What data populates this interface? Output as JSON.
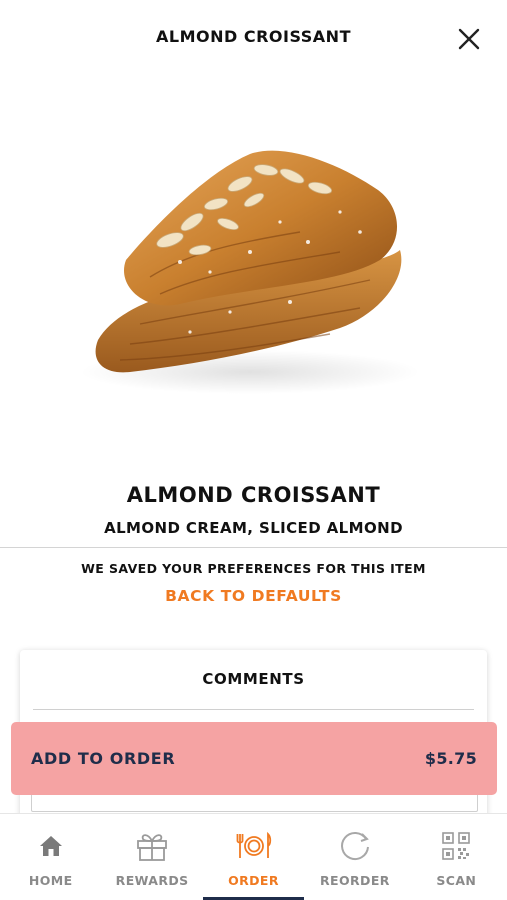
{
  "header": {
    "title": "ALMOND CROISSANT",
    "close_icon": "close-icon"
  },
  "product": {
    "name": "ALMOND CROISSANT",
    "description": "ALMOND CREAM, SLICED ALMOND"
  },
  "preferences": {
    "note": "WE SAVED YOUR PREFERENCES FOR THIS ITEM",
    "reset_link": "BACK TO DEFAULTS"
  },
  "comments": {
    "title": "COMMENTS",
    "value": ""
  },
  "order_bar": {
    "label": "ADD TO ORDER",
    "price": "$5.75"
  },
  "tabs": [
    {
      "label": "HOME",
      "icon": "home-icon",
      "active": false
    },
    {
      "label": "REWARDS",
      "icon": "gift-icon",
      "active": false
    },
    {
      "label": "ORDER",
      "icon": "plate-cutlery-icon",
      "active": true
    },
    {
      "label": "REORDER",
      "icon": "reorder-icon",
      "active": false
    },
    {
      "label": "SCAN",
      "icon": "qr-code-icon",
      "active": false
    }
  ],
  "colors": {
    "accent": "#f07a21",
    "navy": "#1f2d4a",
    "order_button": "#f5a3a3",
    "inactive_tab": "#8a8a8a"
  }
}
